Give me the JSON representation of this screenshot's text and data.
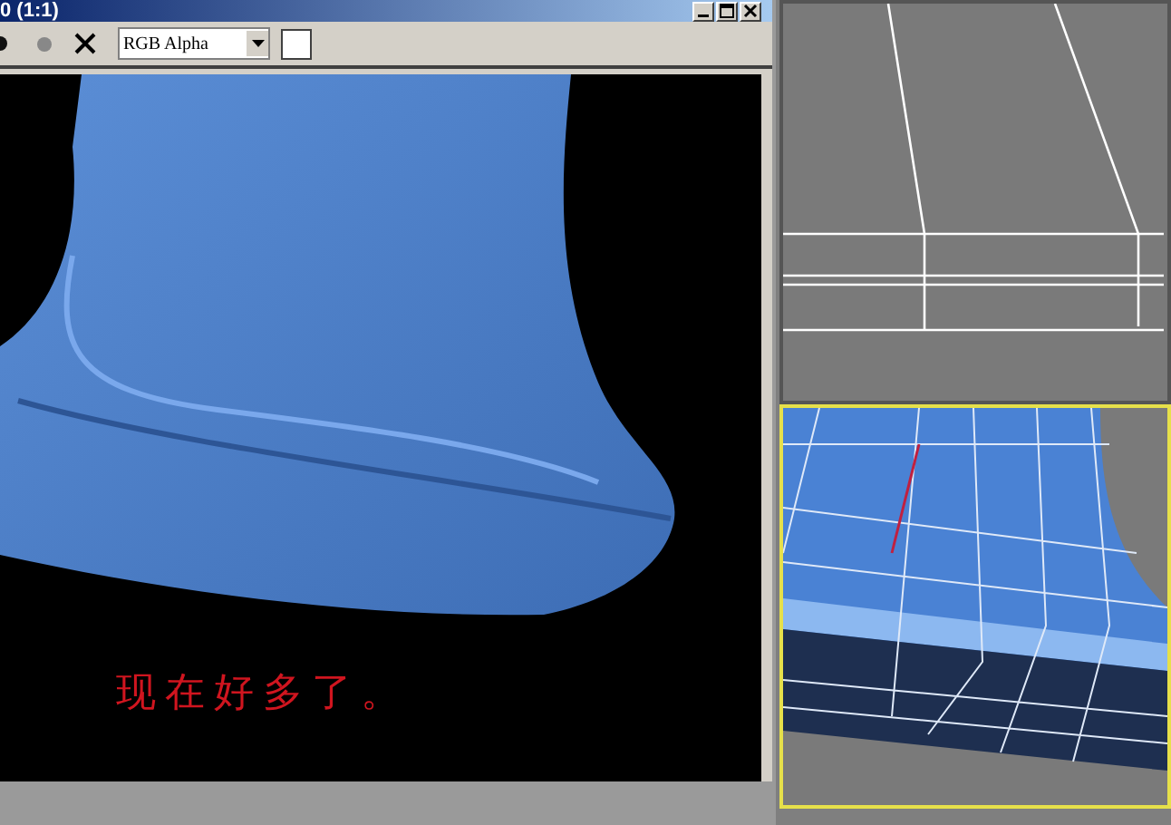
{
  "render_window": {
    "title": "0 (1:1)",
    "channel_dropdown": {
      "value": "RGB Alpha"
    },
    "caption": "现在好多了。"
  },
  "viewports": [
    {
      "kind": "wireframe",
      "selected": false
    },
    {
      "kind": "shaded",
      "selected": true
    }
  ]
}
